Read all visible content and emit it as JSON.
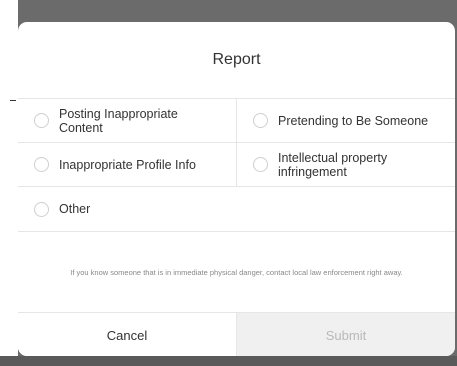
{
  "dialog": {
    "title": "Report",
    "options": [
      {
        "label": "Posting Inappropriate Content"
      },
      {
        "label": "Pretending to Be Someone"
      },
      {
        "label": "Inappropriate Profile Info"
      },
      {
        "label": "Intellectual property infringement"
      },
      {
        "label": "Other"
      }
    ],
    "info_text": "If you know someone that is in immediate physical danger, contact local law enforcement right away.",
    "cancel_label": "Cancel",
    "submit_label": "Submit"
  },
  "colors": {
    "overlay": "#6b6b6b",
    "modal_bg": "#ffffff",
    "divider": "#e6e6e6",
    "submit_disabled_bg": "#f0f0f0",
    "submit_disabled_text": "#b9b9b9"
  }
}
